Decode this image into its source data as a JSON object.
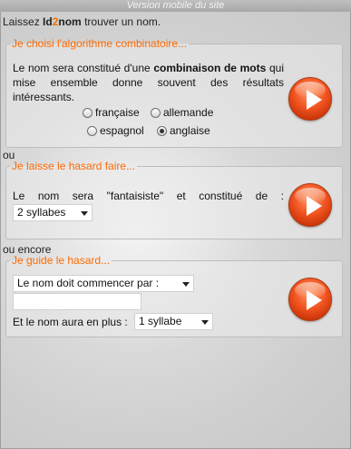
{
  "header": {
    "mobile_version_label": "Version mobile du site"
  },
  "intro": {
    "before": "Laissez ",
    "brand_a": "Id",
    "brand_mid": "2",
    "brand_b": "nom",
    "after": " trouver un nom."
  },
  "section1": {
    "legend": "Je choisi l'algorithme combinatoire...",
    "text_a": "Le nom sera constitué d'une ",
    "text_bold": "combinaison de mots",
    "text_b": " qui mise ensemble donne souvent des résultats intéressants.",
    "radios": [
      {
        "label": "française",
        "checked": false
      },
      {
        "label": "allemande",
        "checked": false
      },
      {
        "label": "espagnol",
        "checked": false
      },
      {
        "label": "anglaise",
        "checked": true
      }
    ]
  },
  "sep1": "ou",
  "section2": {
    "legend": "Je laisse le hasard faire...",
    "text": "Le nom sera \"fantaisiste\" et constitué de :",
    "syllables_select": "2 syllabes"
  },
  "sep2": "ou encore",
  "section3": {
    "legend": "Je guide le hasard...",
    "position_select": "Le nom doit commencer par :",
    "text_input_value": "",
    "extra_label": "Et le nom aura en plus :",
    "extra_select": "1 syllabe"
  },
  "colors": {
    "accent": "#ff6a00",
    "play_button": "#e04a18"
  },
  "icons": {
    "play": "play-icon"
  }
}
